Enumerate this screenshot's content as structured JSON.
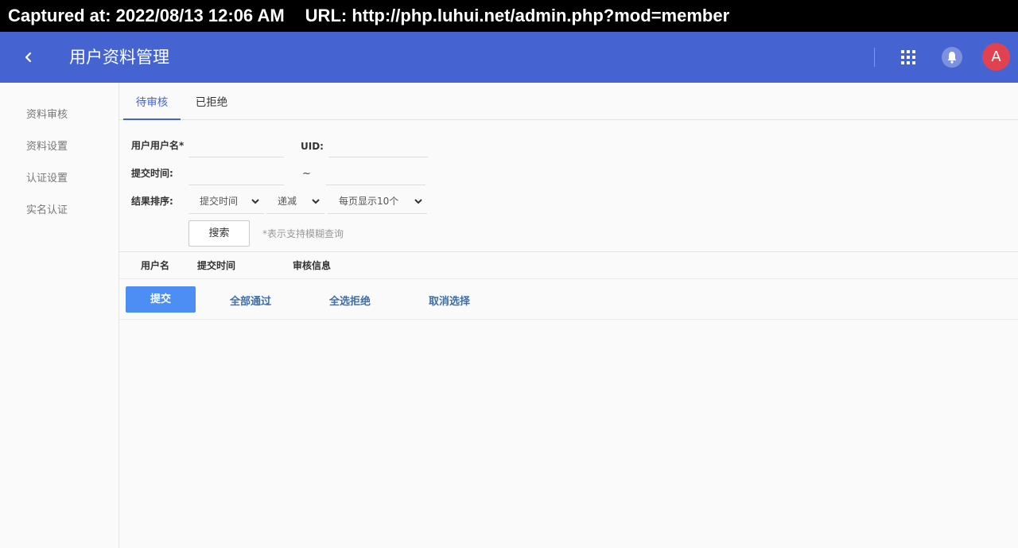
{
  "capture": {
    "captured_at": "Captured at: 2022/08/13 12:06 AM",
    "url": "URL: http://php.luhui.net/admin.php?mod=member"
  },
  "header": {
    "title": "用户资料管理",
    "avatar_letter": "A",
    "back_icon": "chevron-left-icon",
    "apps_icon": "grid-icon",
    "bell_icon": "bell-icon",
    "colors": {
      "bar": "#4564d2",
      "avatar": "#e2424f"
    }
  },
  "sidebar": {
    "items": [
      {
        "label": "资料审核"
      },
      {
        "label": "资料设置"
      },
      {
        "label": "认证设置"
      },
      {
        "label": "实名认证"
      }
    ]
  },
  "tabs": [
    {
      "label": "待审核",
      "active": true
    },
    {
      "label": "已拒绝",
      "active": false
    }
  ],
  "filters": {
    "username_label": "用户用户名*",
    "username_value": "",
    "uid_label": "UID:",
    "uid_value": "",
    "submit_time_label": "提交时间:",
    "time_start": "",
    "time_separator": "~",
    "time_end": "",
    "sort_label": "结果排序:",
    "sort_field": "提交时间",
    "sort_order": "递减",
    "page_size": "每页显示10个",
    "search_button": "搜索",
    "hint": "*表示支持模糊查询"
  },
  "table": {
    "columns": [
      "用户名",
      "提交时间",
      "审核信息"
    ]
  },
  "actions": {
    "submit": "提交",
    "approve_all": "全部通过",
    "reject_all": "全选拒绝",
    "cancel_selection": "取消选择",
    "colors": {
      "primary": "#4c8ef3",
      "link": "#3d6ea8"
    }
  }
}
